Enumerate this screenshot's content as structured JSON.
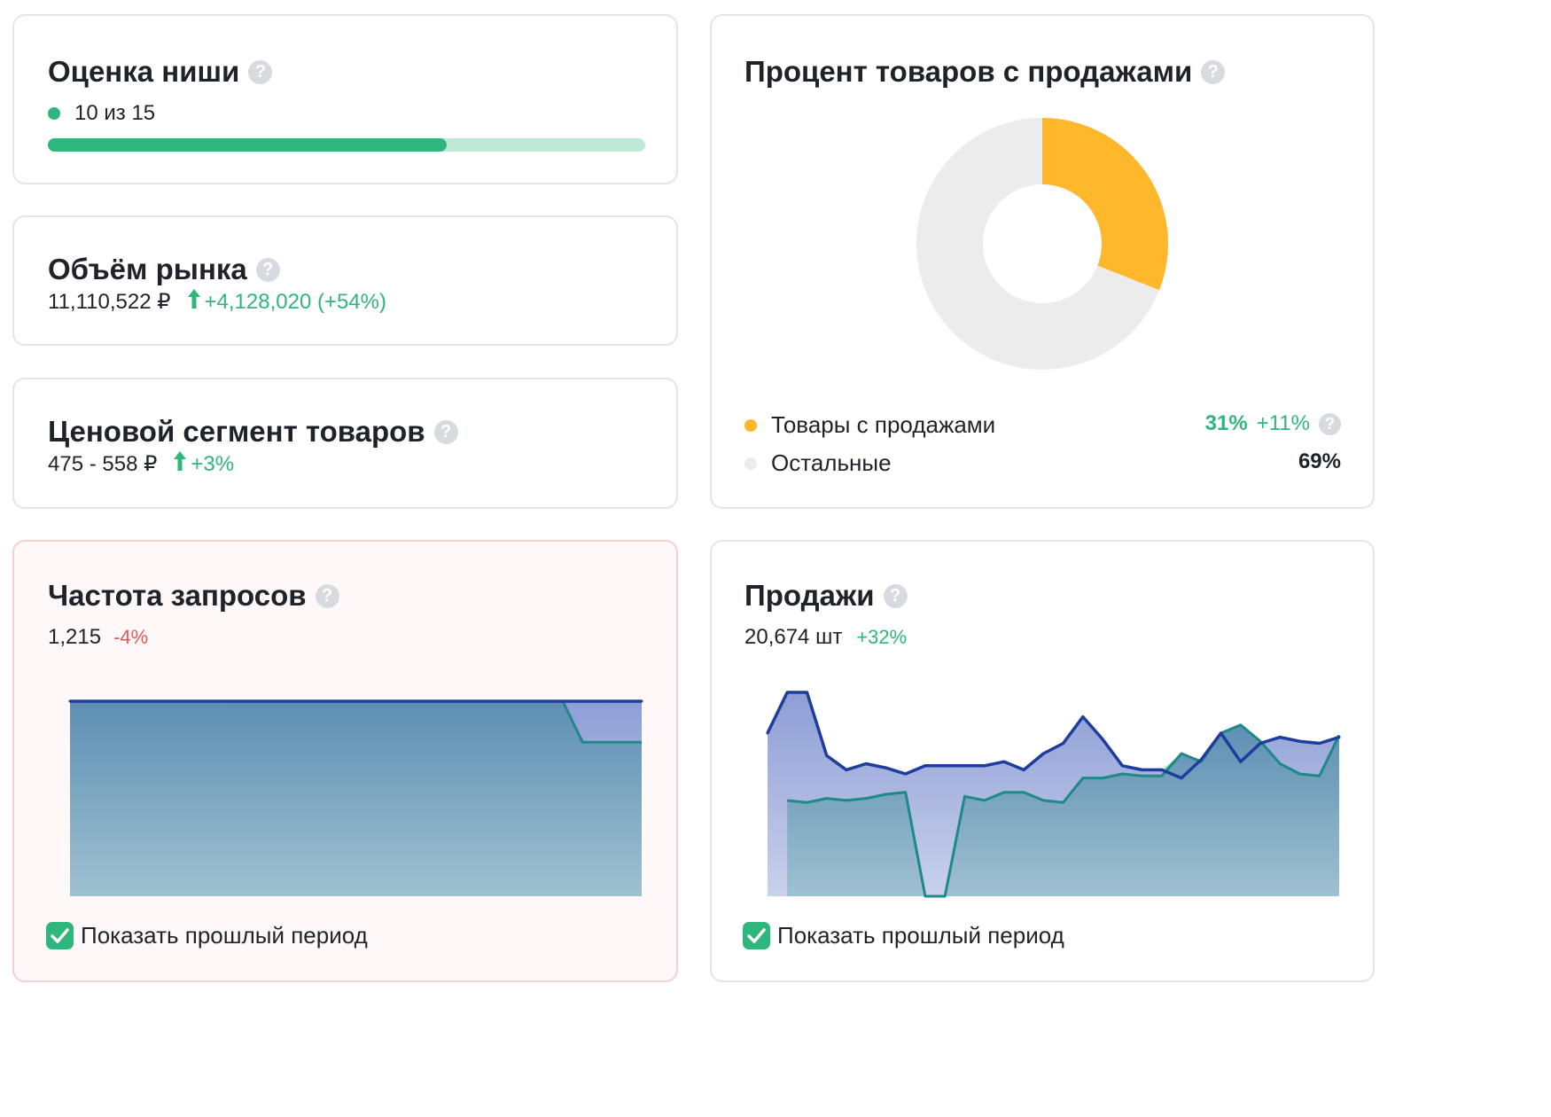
{
  "niche_score": {
    "title": "Оценка ниши",
    "value": "10 из 15",
    "progress": 0.667,
    "colors": {
      "dot": "#2fb67c",
      "fill": "#2fb67c",
      "track": "#bfe9d6"
    }
  },
  "market_volume": {
    "title": "Объём рынка",
    "value": "11,110,522 ₽",
    "delta": "+4,128,020 (+54%)"
  },
  "price_segment": {
    "title": "Ценовой сегмент товаров",
    "value": "475 - 558 ₽",
    "delta": "+3%"
  },
  "products_with_sales": {
    "title": "Процент товаров с продажами",
    "legend": [
      {
        "label": "Товары с продажами",
        "value": "31%",
        "delta": "+11%",
        "color": "#ffb72b"
      },
      {
        "label": "Остальные",
        "value": "69%",
        "color": "#ececed"
      }
    ]
  },
  "query_frequency": {
    "title": "Частота запросов",
    "value": "1,215",
    "delta": "-4%",
    "checkbox_label": "Показать прошлый период",
    "checkbox_checked": true
  },
  "sales": {
    "title": "Продажи",
    "value": "20,674 шт",
    "delta": "+32%",
    "checkbox_label": "Показать прошлый период",
    "checkbox_checked": true
  },
  "help_icon_glyph": "?",
  "colors": {
    "positive": "#2fb67c",
    "negative": "#e0595c",
    "current_line": "#1f3d9c",
    "previous_line": "#1d8a87",
    "previous_higher_fill": "#97dcbf"
  },
  "chart_data": [
    {
      "type": "pie",
      "labels": [
        "Товары с продажами",
        "Остальные"
      ],
      "values": [
        31,
        69
      ],
      "colors": [
        "#ffb72b",
        "#ececed"
      ]
    },
    {
      "type": "area",
      "series": [
        {
          "values": [
            100,
            100,
            100,
            100,
            100,
            100,
            100,
            100,
            100,
            100,
            100,
            100,
            100,
            100,
            100,
            100,
            100,
            100,
            100,
            100,
            100,
            100,
            100,
            100,
            100,
            100,
            100,
            100,
            100,
            100
          ]
        },
        {
          "values": [
            100,
            100,
            100,
            100,
            100,
            100,
            100,
            100,
            100,
            100,
            100,
            100,
            100,
            100,
            100,
            100,
            100,
            100,
            100,
            100,
            100,
            100,
            100,
            100,
            100,
            100,
            79,
            79,
            79,
            79
          ]
        }
      ],
      "ylim": [
        0,
        100
      ]
    },
    {
      "type": "area",
      "series": [
        {
          "values": [
            80,
            100,
            100,
            69,
            62,
            65,
            63,
            60,
            64,
            64,
            64,
            64,
            66,
            62,
            70,
            75,
            88,
            77,
            64,
            62,
            62,
            58,
            67,
            80,
            66,
            75,
            78,
            76,
            75,
            78
          ]
        },
        {
          "values": [
            null,
            47,
            46,
            48,
            47,
            48,
            50,
            51,
            0,
            0,
            49,
            47,
            51,
            51,
            47,
            46,
            58,
            58,
            60,
            59,
            59,
            70,
            66,
            80,
            84,
            76,
            65,
            60,
            59,
            79
          ]
        }
      ],
      "ylim": [
        0,
        100
      ]
    }
  ]
}
